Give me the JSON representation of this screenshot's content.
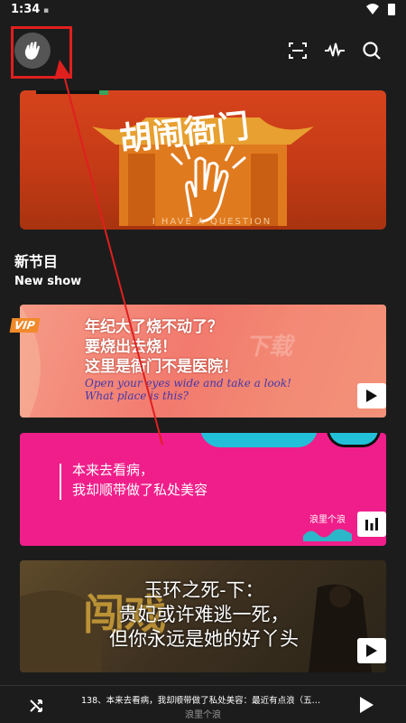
{
  "status_bar": {
    "time": "1:34",
    "notif": "▪"
  },
  "banner": {
    "title": "胡闹衙门",
    "subtitle": "I HAVE A QUESTION"
  },
  "section": {
    "title_zh": "新节目",
    "title_en": "New show"
  },
  "cards": [
    {
      "badge": "VIP",
      "lines_zh": [
        "年纪大了烧不动了？",
        "要烧出去烧！",
        "这里是衙门不是医院！"
      ],
      "lines_en": [
        "Open your eyes wide and take a look!",
        "What place is this?"
      ],
      "watermark": "下载"
    },
    {
      "lines_zh": [
        "本来去看病，",
        "我却顺带做了私处美容"
      ],
      "logo": "浪里个浪"
    },
    {
      "bg_text": "闯戏",
      "lines_zh": [
        "玉环之死-下：",
        "贵妃或许难逃一死，",
        "但你永远是她的好丫头"
      ]
    }
  ],
  "player": {
    "title": "138、本来去看病，我却顺带做了私处美容：最近有点浪（五…",
    "subtitle": "浪里个浪"
  },
  "icons": {
    "avatar": "hand-wave-icon",
    "scan": "scan-icon",
    "audio": "waveform-icon",
    "search": "search-icon",
    "shuffle": "shuffle-icon",
    "play": "play-icon"
  },
  "colors": {
    "background": "#1c1c1c",
    "highlight": "#e01f1f",
    "card2": "#f01e8a"
  }
}
